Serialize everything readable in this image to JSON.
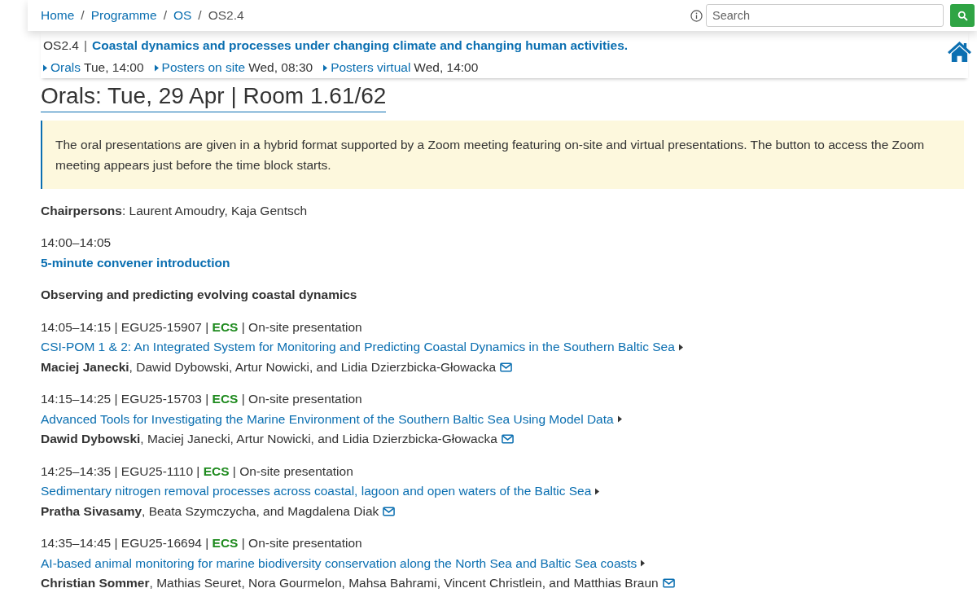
{
  "breadcrumb": [
    {
      "label": "Home",
      "link": true
    },
    {
      "separator": "/",
      "label": "Programme",
      "link": true
    },
    {
      "separator": "/",
      "label": "OS",
      "link": true
    },
    {
      "separator": "/",
      "label": "OS2.4",
      "link": false
    }
  ],
  "search": {
    "placeholder": "Search"
  },
  "session": {
    "code": "OS2.4",
    "separator": "|",
    "title": "Coastal dynamics and processes under changing climate and changing human activities."
  },
  "session_nav": [
    {
      "label": "Orals",
      "time": "Tue, 14:00"
    },
    {
      "label": "Posters on site",
      "time": "Wed, 08:30"
    },
    {
      "label": "Posters virtual",
      "time": "Wed, 14:00"
    }
  ],
  "heading": "Orals: Tue, 29 Apr | Room 1.61/62",
  "notice": "The oral presentations are given in a hybrid format supported by a Zoom meeting featuring on-site and virtual presentations. The button to access the Zoom meeting appears just before the time block starts.",
  "chairpersons": "**Chairpersons**: Laurent Amoudry, Kaja Gentsch",
  "intro": {
    "time": "14:00–14:05",
    "title": "5-minute convener introduction"
  },
  "block_title": "Observing and predicting evolving coastal dynamics",
  "presentations": [
    {
      "meta": "14:05–14:15 | EGU25-15907 | **ECS** | On-site presentation",
      "title": "CSI-POM 1 & 2: An Integrated System for Monitoring and Predicting Coastal Dynamics in the Southern Baltic Sea",
      "authors": "**Maciej Janecki**, Dawid Dybowski, Artur Nowicki, and Lidia Dzierzbicka-Głowacka"
    },
    {
      "meta": "14:15–14:25 | EGU25-15703 | **ECS** | On-site presentation",
      "title": "Advanced Tools for Investigating the Marine Environment of the Southern Baltic Sea Using Model Data",
      "authors": "**Dawid Dybowski**, Maciej Janecki, Artur Nowicki, and Lidia Dzierzbicka-Głowacka"
    },
    {
      "meta": "14:25–14:35 | EGU25-1110 | **ECS** | On-site presentation",
      "title": "Sedimentary nitrogen removal processes across coastal, lagoon and open waters of the Baltic Sea",
      "authors": "**Pratha Sivasamy**, Beata Szymczycha, and Magdalena Diak"
    },
    {
      "meta": "14:35–14:45 | EGU25-16694 | **ECS** | On-site presentation",
      "title": "AI-based animal monitoring for marine biodiversity conservation along the North Sea and Baltic Sea coasts",
      "authors": "**Christian Sommer**, Mathias Seuret, Nora Gourmelon, Mahsa Bahrami, Vincent Christlein, and Matthias Braun"
    }
  ]
}
